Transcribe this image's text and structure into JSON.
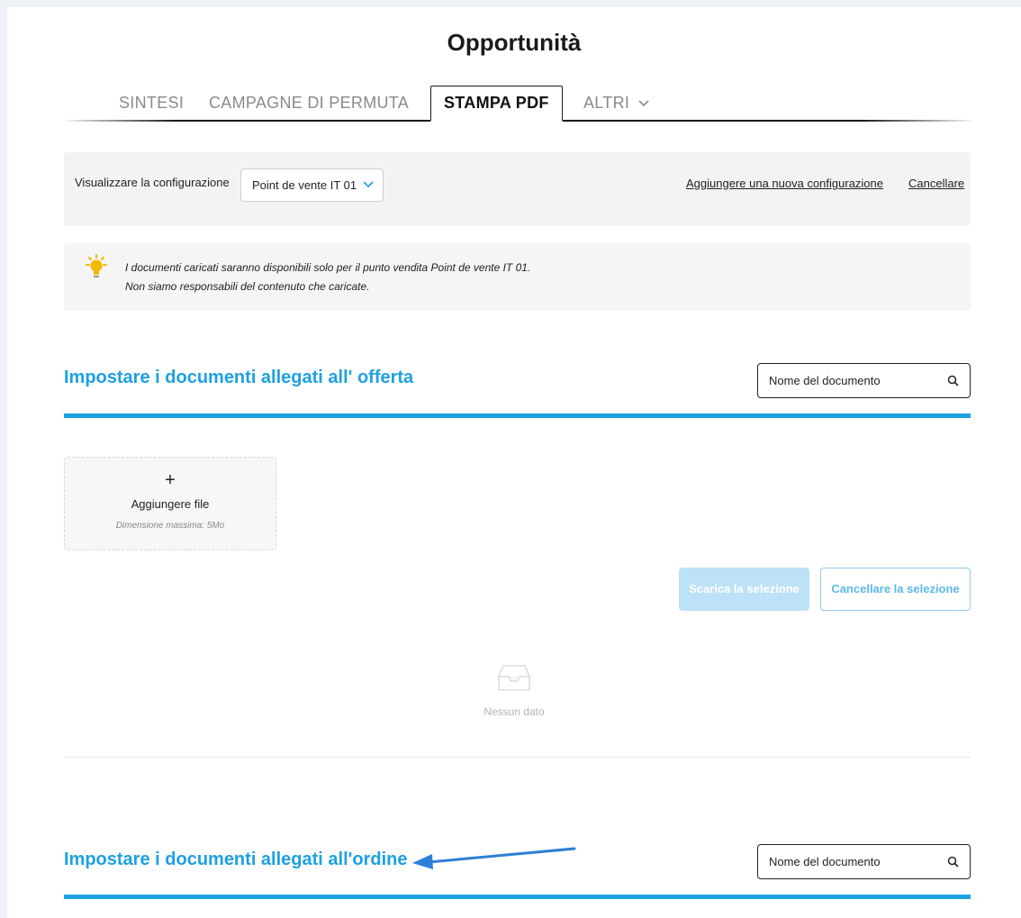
{
  "page": {
    "title": "Opportunità"
  },
  "tabs": [
    {
      "label": "SINTESI",
      "active": false
    },
    {
      "label": "CAMPAGNE DI PERMUTA",
      "active": false
    },
    {
      "label": "STAMPA PDF",
      "active": true
    },
    {
      "label": "ALTRI",
      "active": false,
      "has_dropdown": true
    }
  ],
  "config": {
    "label": "Visualizzare la configurazione",
    "selected": "Point de vente IT 01",
    "add_link": "Aggiungere una nuova configurazione",
    "cancel_link": "Cancellare"
  },
  "info": {
    "icon": "lightbulb-icon",
    "line1": "I documenti caricati saranno disponibili solo per il punto vendita Point de vente IT 01.",
    "line2": "Non siamo responsabili del contenuto che caricate."
  },
  "offer_section": {
    "title": "Impostare i documenti allegati all' offerta",
    "search_placeholder": "Nome del documento",
    "upload": {
      "plus": "+",
      "label": "Aggiungere file",
      "hint": "Dimensione massima: 5Mo"
    },
    "download_button": "Scarica la selezione",
    "cancel_button": "Cancellare la selezione",
    "empty_text": "Nessun dato"
  },
  "order_section": {
    "title": "Impostare i documenti allegati all'ordine",
    "search_placeholder": "Nome del documento"
  },
  "colors": {
    "accent": "#1ea1e0",
    "button_disabled": "#bde1f6",
    "annotation_arrow": "#2b7fd6"
  }
}
